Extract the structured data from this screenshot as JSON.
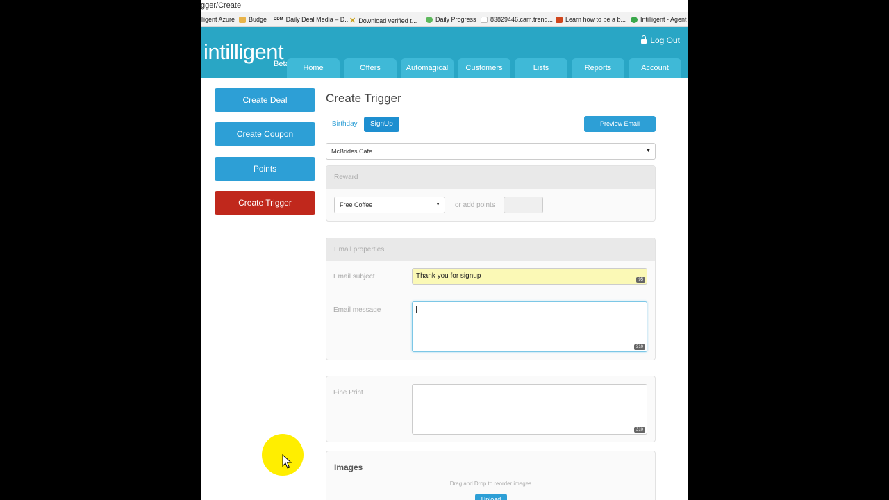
{
  "browser": {
    "url_fragment": "gger/Create",
    "bookmarks": [
      {
        "label": "lligent Azure",
        "icon": "none",
        "color": "#ffffff"
      },
      {
        "label": "Budge",
        "icon": "folder-icon",
        "color": "#e8b44a"
      },
      {
        "label": "Daily Deal Media – D...",
        "icon": "ddm-icon",
        "color": "#333333"
      },
      {
        "label": "Download verified t...",
        "icon": "x-icon",
        "color": "#c9a11a"
      },
      {
        "label": "Daily Progress",
        "icon": "cloud-icon",
        "color": "#5db85c"
      },
      {
        "label": "83829446.cam.trend...",
        "icon": "page-icon",
        "color": "#bbbbbb"
      },
      {
        "label": "Learn how to be a b...",
        "icon": "book-icon",
        "color": "#d0461d"
      },
      {
        "label": "Intilligent - Agent",
        "icon": "gear-icon",
        "color": "#3aa84b"
      }
    ]
  },
  "header": {
    "logo": "intilligent",
    "beta": "Beta",
    "logout": "Log Out",
    "nav": [
      "Home",
      "Offers",
      "Automagical",
      "Customers",
      "Lists",
      "Reports",
      "Account"
    ]
  },
  "sidebar": {
    "items": [
      "Create Deal",
      "Create Coupon",
      "Points",
      "Create Trigger"
    ],
    "active_color": "#c0281c",
    "button_color": "#2d9fd6"
  },
  "main": {
    "title": "Create Trigger",
    "tabs": [
      {
        "label": "Birthday",
        "active": false
      },
      {
        "label": "SignUp",
        "active": true
      }
    ],
    "preview_button": "Preview Email",
    "location_select": "McBrides Cafe",
    "reward": {
      "heading": "Reward",
      "select_value": "Free Coffee",
      "points_label": "or add points",
      "points_value": ""
    },
    "email": {
      "heading": "Email properties",
      "subject_label": "Email subject",
      "subject_value": "Thank you for signup",
      "subject_counter": "95",
      "message_label": "Email message",
      "message_value": "",
      "message_counter": "310"
    },
    "fine_print": {
      "label": "Fine Print",
      "value": "",
      "counter": "310"
    },
    "images": {
      "heading": "Images",
      "hint": "Drag and Drop to reorder images",
      "upload_button": "Upload"
    }
  }
}
